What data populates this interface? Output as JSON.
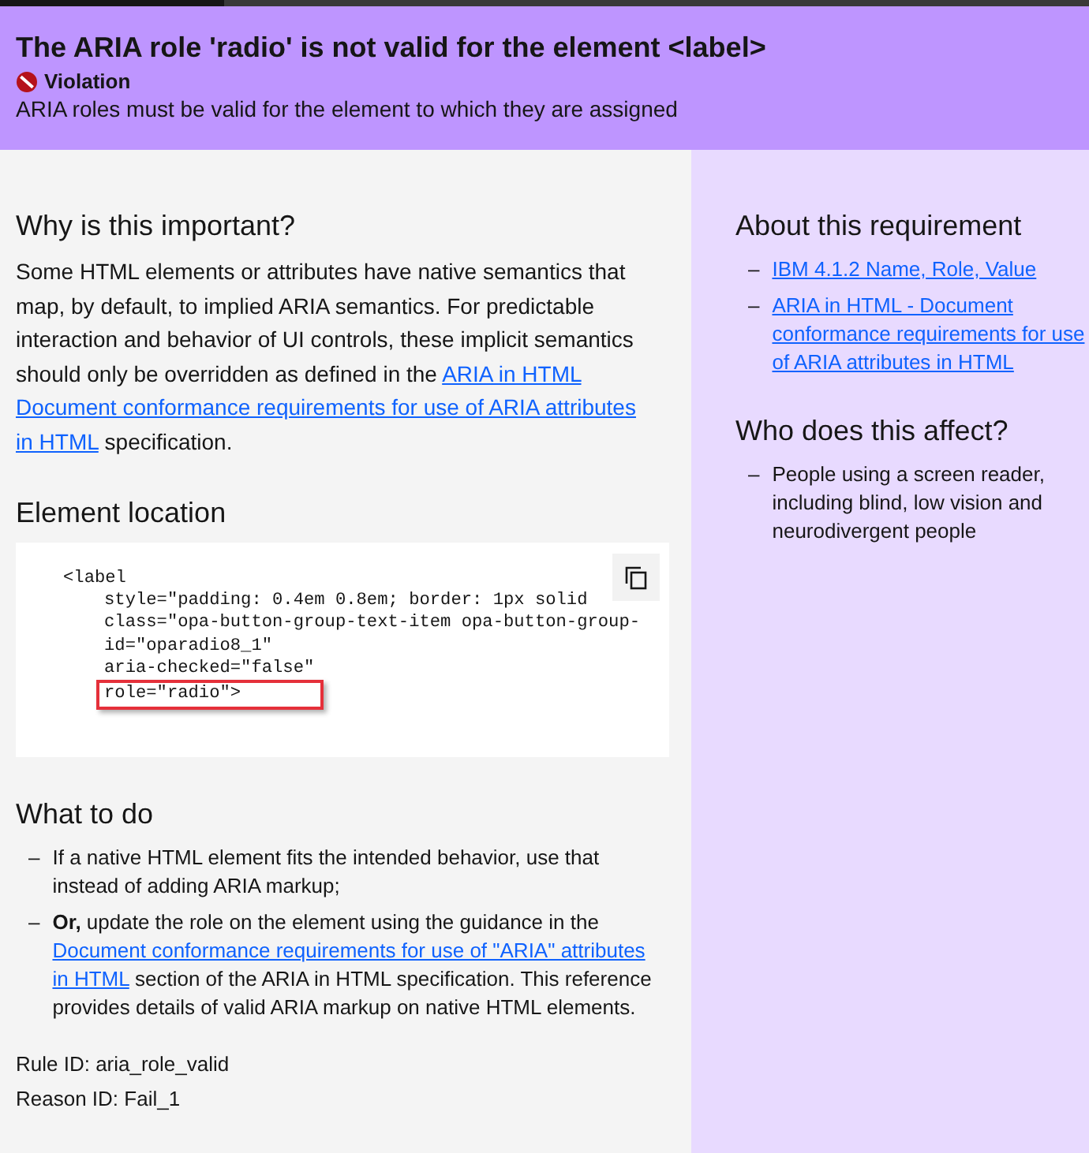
{
  "header": {
    "title": "The ARIA role 'radio' is not valid for the element <label>",
    "status": {
      "kind": "violation",
      "label": "Violation"
    },
    "summary": "ARIA roles must be valid for the element to which they are assigned"
  },
  "main": {
    "sections": [
      {
        "kind": "paragraph",
        "heading": "Why is this important?",
        "parts": [
          {
            "kind": "text",
            "text": "Some HTML elements or attributes have native semantics that map, by default, to implied ARIA semantics. For predictable interaction and behavior of UI controls, these implicit semantics should only be overridden as defined in the "
          },
          {
            "kind": "link",
            "text": "ARIA in HTML"
          },
          {
            "kind": "link",
            "text": "Document conformance requirements for use of ARIA attributes"
          },
          {
            "kind": "link",
            "text": "in HTML"
          },
          {
            "kind": "text",
            "text": " specification."
          }
        ]
      },
      {
        "kind": "code",
        "heading": "Element location",
        "copy_button": true,
        "lines": [
          {
            "text": "<label",
            "highlighted": false
          },
          {
            "text": "style=\"padding: 0.4em 0.8em; border: 1px solid",
            "highlighted": false
          },
          {
            "text": "class=\"opa-button-group-text-item opa-button-group-",
            "highlighted": false
          },
          {
            "text": "id=\"oparadio8_1\"",
            "highlighted": false
          },
          {
            "text": "aria-checked=\"false\"",
            "highlighted": false
          },
          {
            "text": "role=\"radio\">",
            "highlighted": true
          }
        ]
      },
      {
        "kind": "list",
        "heading": "What to do",
        "items": [
          {
            "marker": "–",
            "parts": [
              {
                "kind": "text",
                "text": "If a native HTML element fits the intended behavior, use that instead of adding ARIA markup;"
              }
            ]
          },
          {
            "marker": "–",
            "parts": [
              {
                "kind": "bold",
                "text": "Or,"
              },
              {
                "kind": "text",
                "text": " update the role on the element using the guidance in the "
              },
              {
                "kind": "link",
                "text": "Document conformance requirements for use of \"ARIA\" attributes"
              },
              {
                "kind": "link",
                "text": "in HTML"
              },
              {
                "kind": "text",
                "text": " section of the ARIA in HTML specification. This reference provides details of valid ARIA markup on native HTML elements."
              }
            ]
          }
        ]
      },
      {
        "kind": "ids",
        "lines": [
          "Rule ID: aria_role_valid",
          "Reason ID: Fail_1"
        ]
      }
    ]
  },
  "aside": {
    "sections": [
      {
        "heading": "About this requirement",
        "items": [
          {
            "marker": "–",
            "parts": [
              {
                "kind": "link",
                "text": "IBM 4.1.2 Name, Role, Value"
              }
            ]
          },
          {
            "marker": "–",
            "parts": [
              {
                "kind": "link",
                "text": "ARIA in HTML - Document conformance requirements for use of ARIA attributes in HTML"
              }
            ]
          }
        ]
      },
      {
        "heading": "Who does this affect?",
        "items": [
          {
            "marker": "–",
            "parts": [
              {
                "kind": "text",
                "text": "People using a screen reader, including blind, low vision and neurodivergent people"
              }
            ]
          }
        ]
      }
    ]
  }
}
